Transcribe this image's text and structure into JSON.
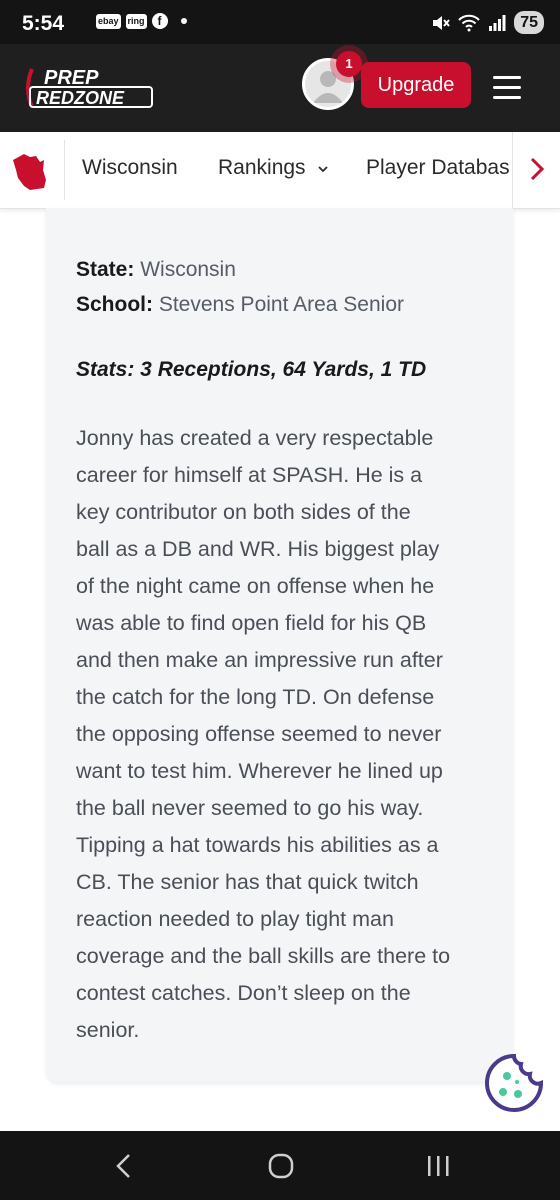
{
  "status_bar": {
    "time": "5:54",
    "notif_icons": [
      "ebay",
      "ring"
    ],
    "battery": "75"
  },
  "header": {
    "logo_line1": "PREP",
    "logo_line2": "REDZONE",
    "notification_count": "1",
    "upgrade_label": "Upgrade"
  },
  "nav": {
    "items": [
      "Wisconsin",
      "Rankings",
      "Player Databas"
    ]
  },
  "player": {
    "state_label": "State:",
    "state_value": "Wisconsin",
    "school_label": "School:",
    "school_value": "Stevens Point Area Senior",
    "stats": "Stats: 3 Receptions, 64 Yards, 1 TD",
    "summary_lines": [
      "Jonny has created a very respectable",
      "career for himself at SPASH. He is a",
      "key contributor on both sides of the",
      "ball as a DB and WR. His biggest play",
      "of the night came on offense when he",
      "was able to find open field for his QB",
      "and then make an impressive run after",
      "the catch for the long TD. On defense",
      "the opposing offense seemed to never",
      "want to test him. Wherever he lined up",
      "the ball never seemed to go his way.",
      "Tipping a hat towards his abilities as a",
      "CB. The senior has that quick twitch",
      "reaction needed to play tight man",
      "coverage and the ball skills are there to",
      "contest catches. Don’t sleep on the",
      "senior."
    ]
  },
  "colors": {
    "brand_red": "#c8102e",
    "header_bg": "#1f1f1f",
    "card_bg": "#f4f5f7",
    "cookie_purple": "#4b3a8c",
    "cookie_dots": "#49c89a"
  }
}
